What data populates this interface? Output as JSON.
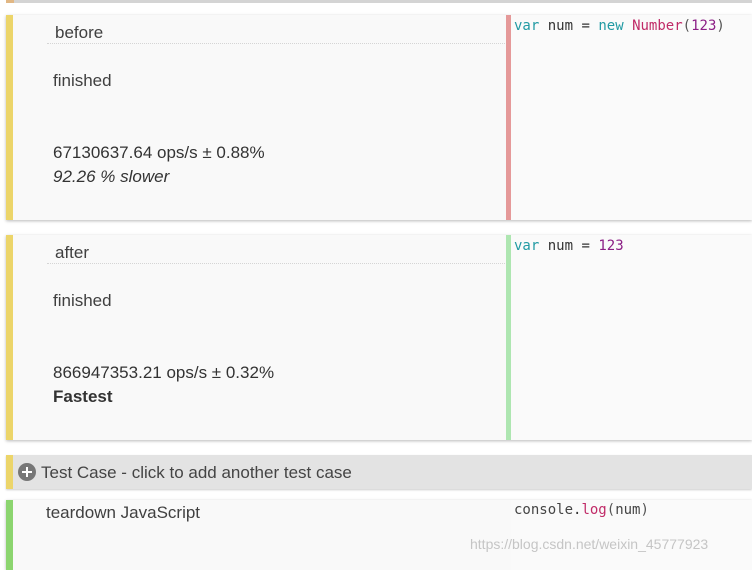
{
  "colors": {
    "stripe_yellow": "#ecd56a",
    "stripe_green": "#8cd56f",
    "divider_red": "#e59999",
    "divider_green": "#aee6b1",
    "add_bar_bg": "#e3e3e3"
  },
  "tests": [
    {
      "name": "before",
      "status": "finished",
      "ops": "67130637.64 ops/s ± 0.88%",
      "comparison": "92.26 % slower",
      "code": "var num = new Number(123)"
    },
    {
      "name": "after",
      "status": "finished",
      "ops": "866947353.21 ops/s ± 0.32%",
      "comparison": "Fastest",
      "code": "var num = 123"
    }
  ],
  "add_test_case": {
    "icon": "plus-circle-icon",
    "label": "Test Case - click to add another test case"
  },
  "teardown": {
    "label": "teardown JavaScript",
    "code": "console.log(num)"
  },
  "watermark": "https://blog.csdn.net/weixin_45777923"
}
